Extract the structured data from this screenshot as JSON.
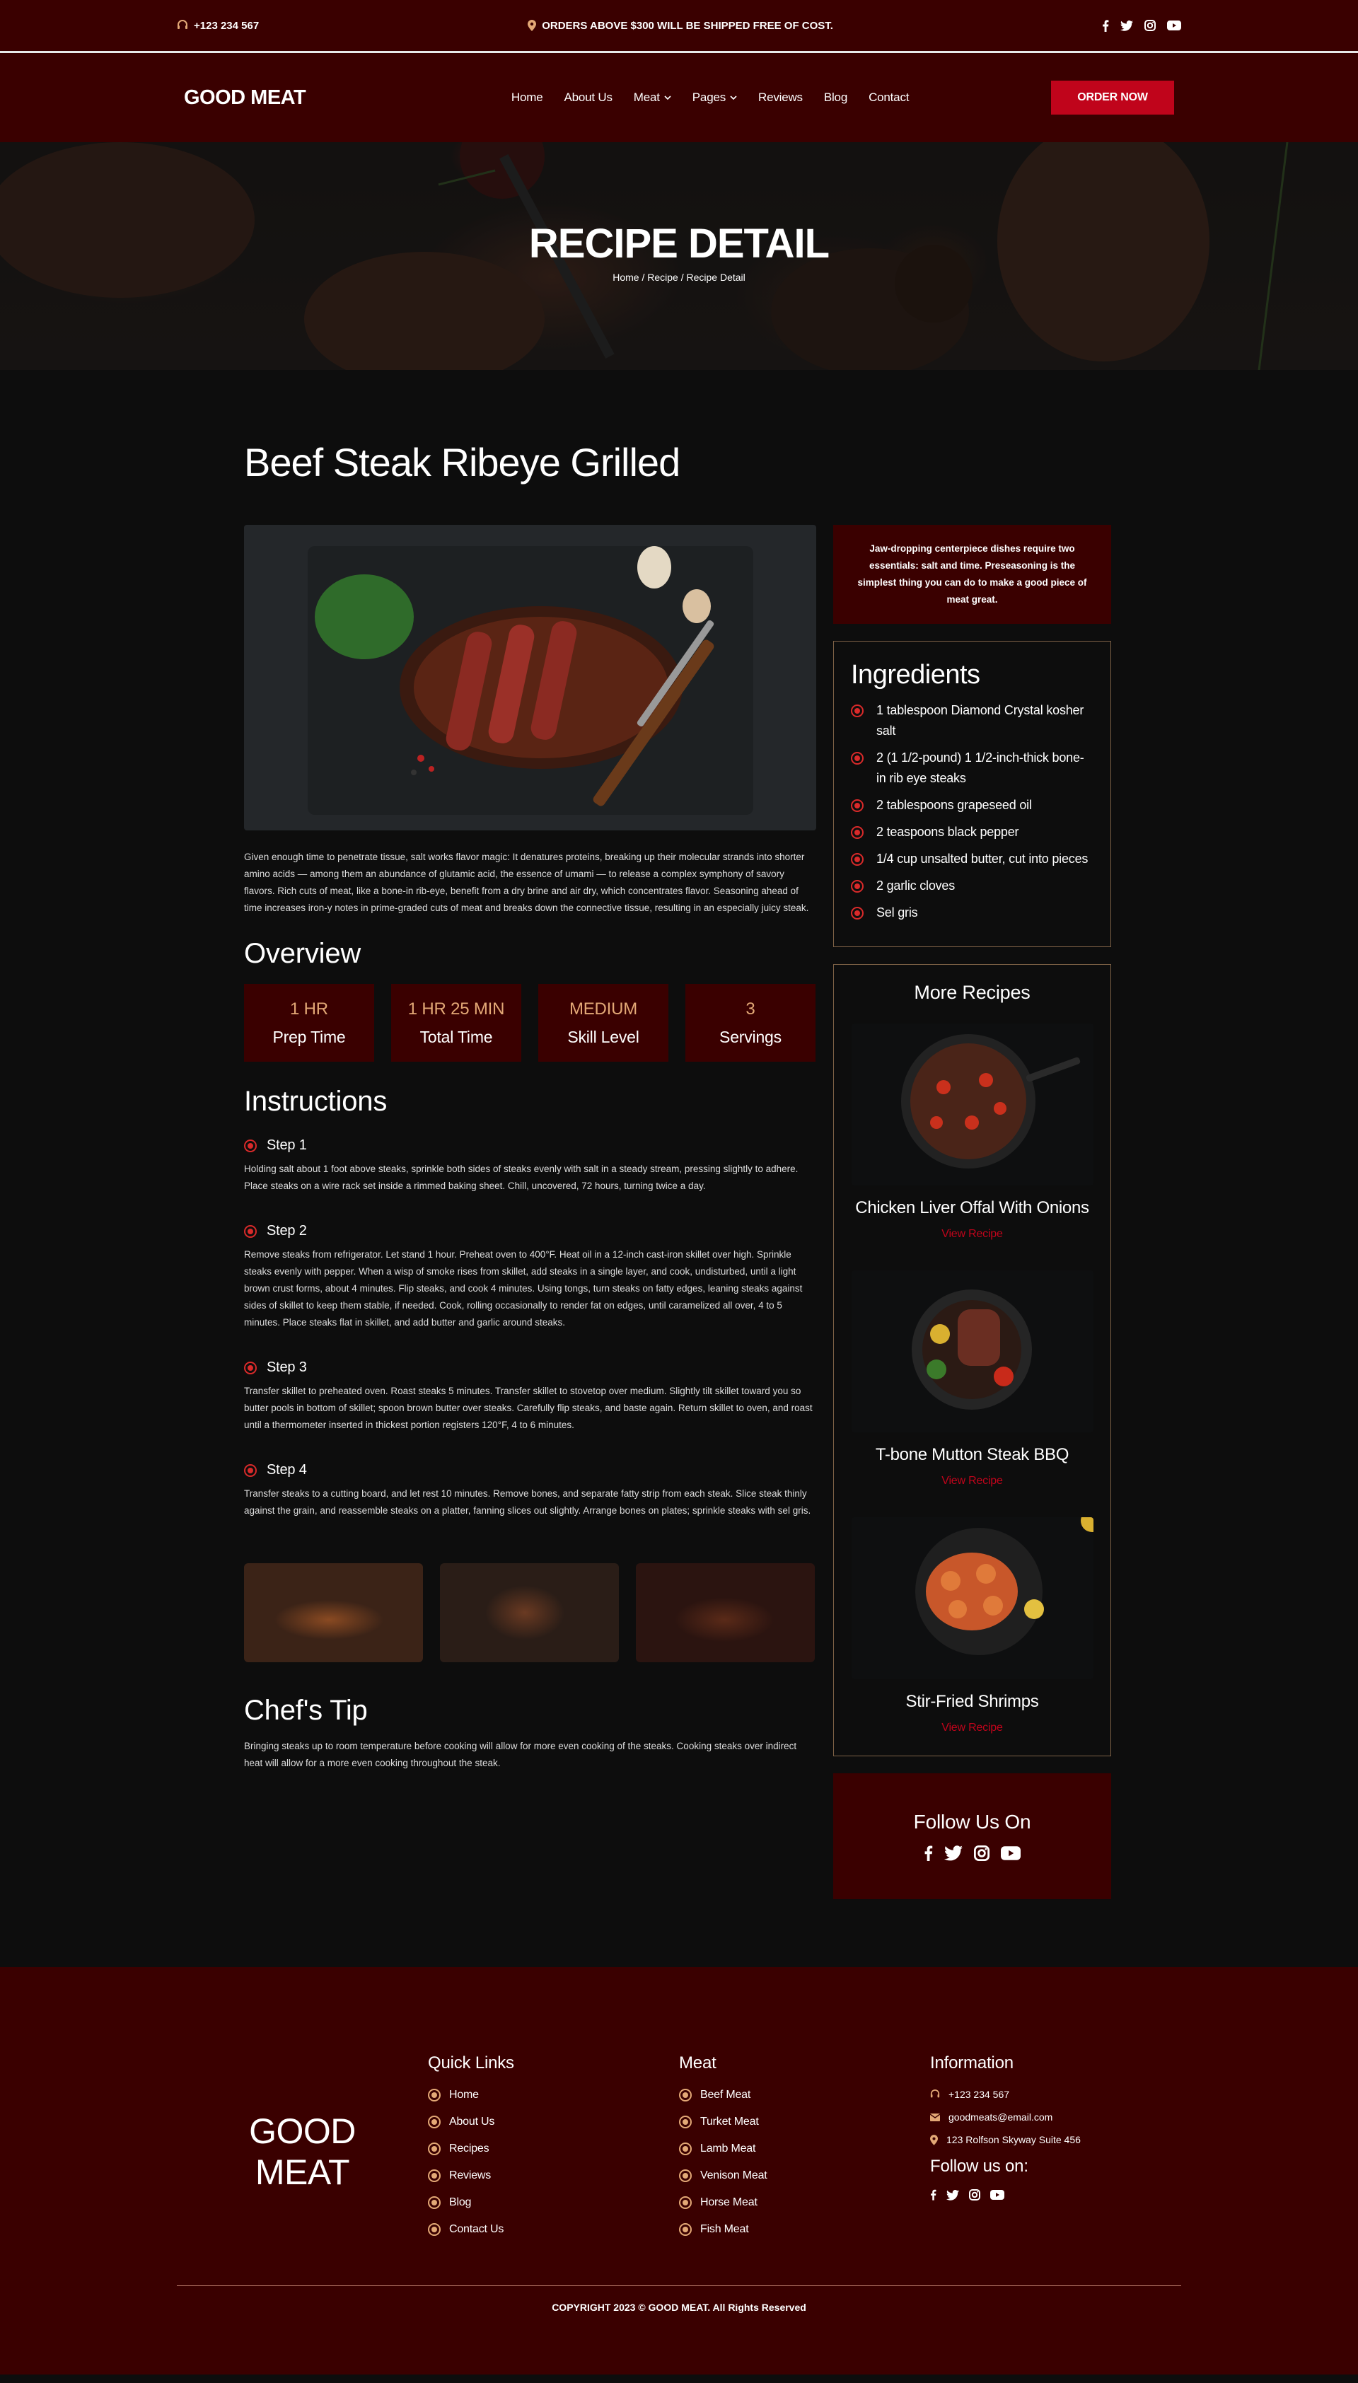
{
  "topbar": {
    "phone": "+123 234 567",
    "shipping": "ORDERS ABOVE $300 WILL BE SHIPPED FREE OF COST.",
    "social": [
      "facebook-icon",
      "twitter-icon",
      "instagram-icon",
      "youtube-icon"
    ]
  },
  "nav": {
    "logo": "GOOD MEAT",
    "items": [
      "Home",
      "About Us",
      "Meat",
      "Pages",
      "Reviews",
      "Blog",
      "Contact"
    ],
    "order_label": "ORDER NOW"
  },
  "hero": {
    "title": "RECIPE DETAIL",
    "breadcrumb": "Home / Recipe / Recipe Detail"
  },
  "recipe": {
    "title": "Beef Steak Ribeye Grilled",
    "description": "Given enough time to penetrate tissue, salt works flavor magic: It denatures proteins, breaking up their molecular strands into shorter amino acids — among them an abundance of glutamic acid, the essence of umami — to release a complex symphony of savory flavors. Rich cuts of meat, like a bone-in rib-eye, benefit from a dry brine and air dry, which concentrates flavor. Seasoning ahead of time increases iron-y notes in prime-graded cuts of meat and breaks down the connective tissue, resulting in an especially juicy steak.",
    "overview_title": "Overview",
    "overview": [
      {
        "value": "1 HR",
        "label": "Prep Time"
      },
      {
        "value": "1 HR 25 MIN",
        "label": "Total Time"
      },
      {
        "value": "MEDIUM",
        "label": "Skill Level"
      },
      {
        "value": "3",
        "label": "Servings"
      }
    ],
    "instructions_title": "Instructions",
    "steps": [
      {
        "title": "Step 1",
        "text": "Holding salt about 1 foot above steaks, sprinkle both sides of steaks evenly with salt in a steady stream, pressing slightly to adhere. Place steaks on a wire rack set inside a rimmed baking sheet. Chill, uncovered, 72 hours, turning twice a day."
      },
      {
        "title": "Step 2",
        "text": "Remove steaks from refrigerator. Let stand 1 hour. Preheat oven to 400°F. Heat oil in a 12-inch cast-iron skillet over high. Sprinkle steaks evenly with pepper. When a wisp of smoke rises from skillet, add steaks in a single layer, and cook, undisturbed, until a light brown crust forms, about 4 minutes. Flip steaks, and cook 4 minutes. Using tongs, turn steaks on fatty edges, leaning steaks against sides of skillet to keep them stable, if needed. Cook, rolling occasionally to render fat on edges, until caramelized all over, 4 to 5 minutes. Place steaks flat in skillet, and add butter and garlic around steaks."
      },
      {
        "title": "Step 3",
        "text": "Transfer skillet to preheated oven. Roast steaks 5 minutes. Transfer skillet to stovetop over medium. Slightly tilt skillet toward you so butter pools in bottom of skillet; spoon brown butter over steaks. Carefully flip steaks, and baste again. Return skillet to oven, and roast until a thermometer inserted in thickest portion registers 120°F, 4 to 6 minutes."
      },
      {
        "title": "Step 4",
        "text": "Transfer steaks to a cutting board, and let rest 10 minutes. Remove bones, and separate fatty strip from each steak. Slice steak thinly against the grain, and reassemble steaks on a platter, fanning slices out slightly. Arrange bones on plates; sprinkle steaks with sel gris."
      }
    ],
    "tip_title": "Chef's Tip",
    "tip_text": "Bringing steaks up to room temperature before cooking will allow for more even cooking of the steaks. Cooking steaks over indirect heat will allow for a more even cooking throughout the steak."
  },
  "sidebar": {
    "promo": "Jaw-dropping centerpiece dishes require two essentials: salt and time. Preseasoning is the simplest thing you can do to make a good piece of meat great.",
    "ingredients_title": "Ingredients",
    "ingredients": [
      "1 tablespoon Diamond Crystal kosher salt",
      "2 (1 1/2-pound) 1 1/2-inch-thick bone-in rib eye steaks",
      "2 tablespoons grapeseed oil",
      "2 teaspoons black pepper",
      "1/4 cup unsalted butter, cut into pieces",
      "2 garlic cloves",
      "Sel gris"
    ],
    "more_title": "More Recipes",
    "more": [
      {
        "title": "Chicken Liver Offal With Onions",
        "link": "View Recipe"
      },
      {
        "title": "T-bone Mutton Steak BBQ",
        "link": "View Recipe"
      },
      {
        "title": "Stir-Fried Shrimps",
        "link": "View Recipe"
      }
    ],
    "follow_title": "Follow Us On"
  },
  "footer": {
    "logo_line1": "GOOD",
    "logo_line2": "MEAT",
    "quick_title": "Quick Links",
    "quick": [
      "Home",
      "About Us",
      "Recipes",
      "Reviews",
      "Blog",
      "Contact Us"
    ],
    "meat_title": "Meat",
    "meat": [
      "Beef Meat",
      "Turket Meat",
      "Lamb Meat",
      "Venison Meat",
      "Horse Meat",
      "Fish Meat"
    ],
    "info_title": "Information",
    "phone": "+123 234 567",
    "email": "goodmeats@email.com",
    "address": "123 Rolfson Skyway Suite 456",
    "follow_title": "Follow us on:",
    "copyright": "COPYRIGHT 2023 © GOOD MEAT. All Rights Reserved"
  },
  "colors": {
    "maroon": "#3a0000",
    "accent_red": "#c0041b",
    "gold": "#e3a876",
    "page_bg": "#0d0d0d"
  }
}
